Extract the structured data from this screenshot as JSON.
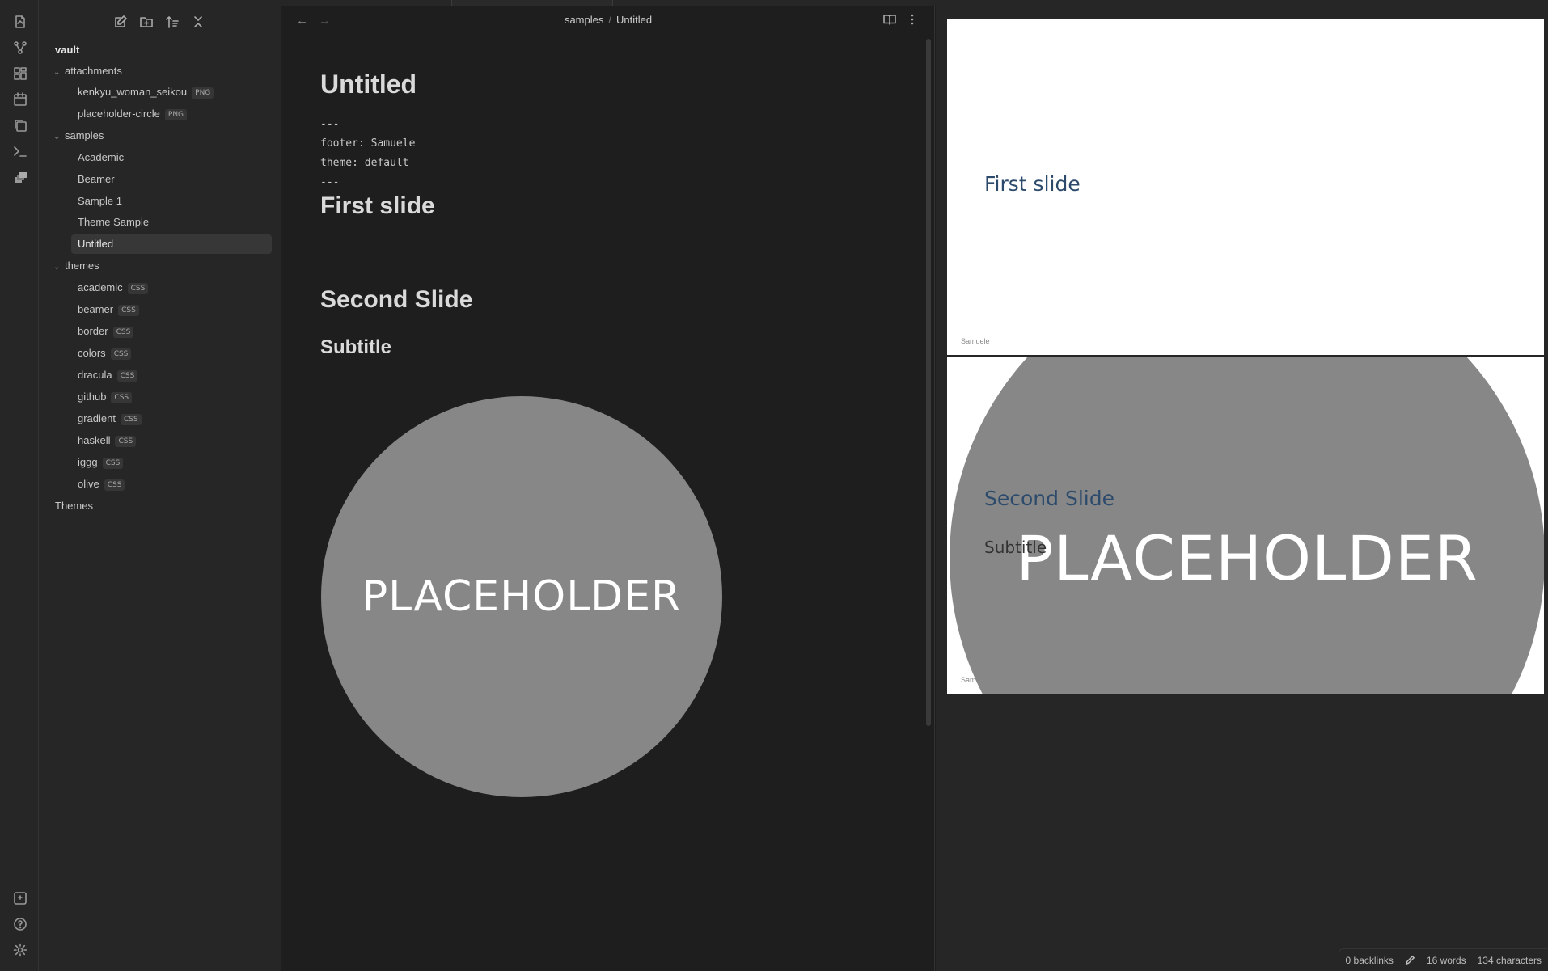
{
  "ribbon": {
    "top_icons": [
      "open-file-icon",
      "graph-icon",
      "canvas-icon",
      "calendar-icon",
      "copy-icon",
      "terminal-icon",
      "slides-icon"
    ],
    "bottom_icons": [
      "vault-switch-icon",
      "help-icon",
      "settings-icon"
    ]
  },
  "sidebar": {
    "actions": [
      "new-note-icon",
      "new-folder-icon",
      "sort-icon",
      "collapse-all-icon"
    ],
    "vault_name": "vault",
    "folders": [
      {
        "name": "attachments",
        "items": [
          {
            "name": "kenkyu_woman_seikou",
            "badge": "PNG"
          },
          {
            "name": "placeholder-circle",
            "badge": "PNG"
          }
        ]
      },
      {
        "name": "samples",
        "items": [
          {
            "name": "Academic",
            "badge": ""
          },
          {
            "name": "Beamer",
            "badge": ""
          },
          {
            "name": "Sample 1",
            "badge": ""
          },
          {
            "name": "Theme Sample",
            "badge": ""
          },
          {
            "name": "Untitled",
            "badge": "",
            "active": true
          }
        ]
      },
      {
        "name": "themes",
        "items": [
          {
            "name": "academic",
            "badge": "CSS"
          },
          {
            "name": "beamer",
            "badge": "CSS"
          },
          {
            "name": "border",
            "badge": "CSS"
          },
          {
            "name": "colors",
            "badge": "CSS"
          },
          {
            "name": "dracula",
            "badge": "CSS"
          },
          {
            "name": "github",
            "badge": "CSS"
          },
          {
            "name": "gradient",
            "badge": "CSS"
          },
          {
            "name": "haskell",
            "badge": "CSS"
          },
          {
            "name": "iggg",
            "badge": "CSS"
          },
          {
            "name": "olive",
            "badge": "CSS"
          }
        ]
      }
    ],
    "top_level_folder": "Themes"
  },
  "editor": {
    "breadcrumb_folder": "samples",
    "breadcrumb_sep": "/",
    "breadcrumb_file": "Untitled",
    "title": "Untitled",
    "frontmatter": [
      "---",
      "footer: Samuele",
      "theme: default",
      "---"
    ],
    "heading_first": "First slide",
    "heading_second": "Second Slide",
    "subtitle": "Subtitle",
    "image_text": "PLACEHOLDER"
  },
  "preview": {
    "slide1": {
      "title": "First slide",
      "footer": "Samuele"
    },
    "slide2": {
      "title": "Second Slide",
      "subtitle": "Subtitle",
      "image_text": "PLACEHOLDER",
      "footer": "Samuele"
    }
  },
  "status": {
    "backlinks": "0 backlinks",
    "words": "16 words",
    "characters": "134 characters"
  },
  "colors": {
    "background": "#1e1e1e",
    "sidebar": "#262626",
    "slide_title": "#2c4a6b",
    "placeholder_circle": "#878787"
  }
}
